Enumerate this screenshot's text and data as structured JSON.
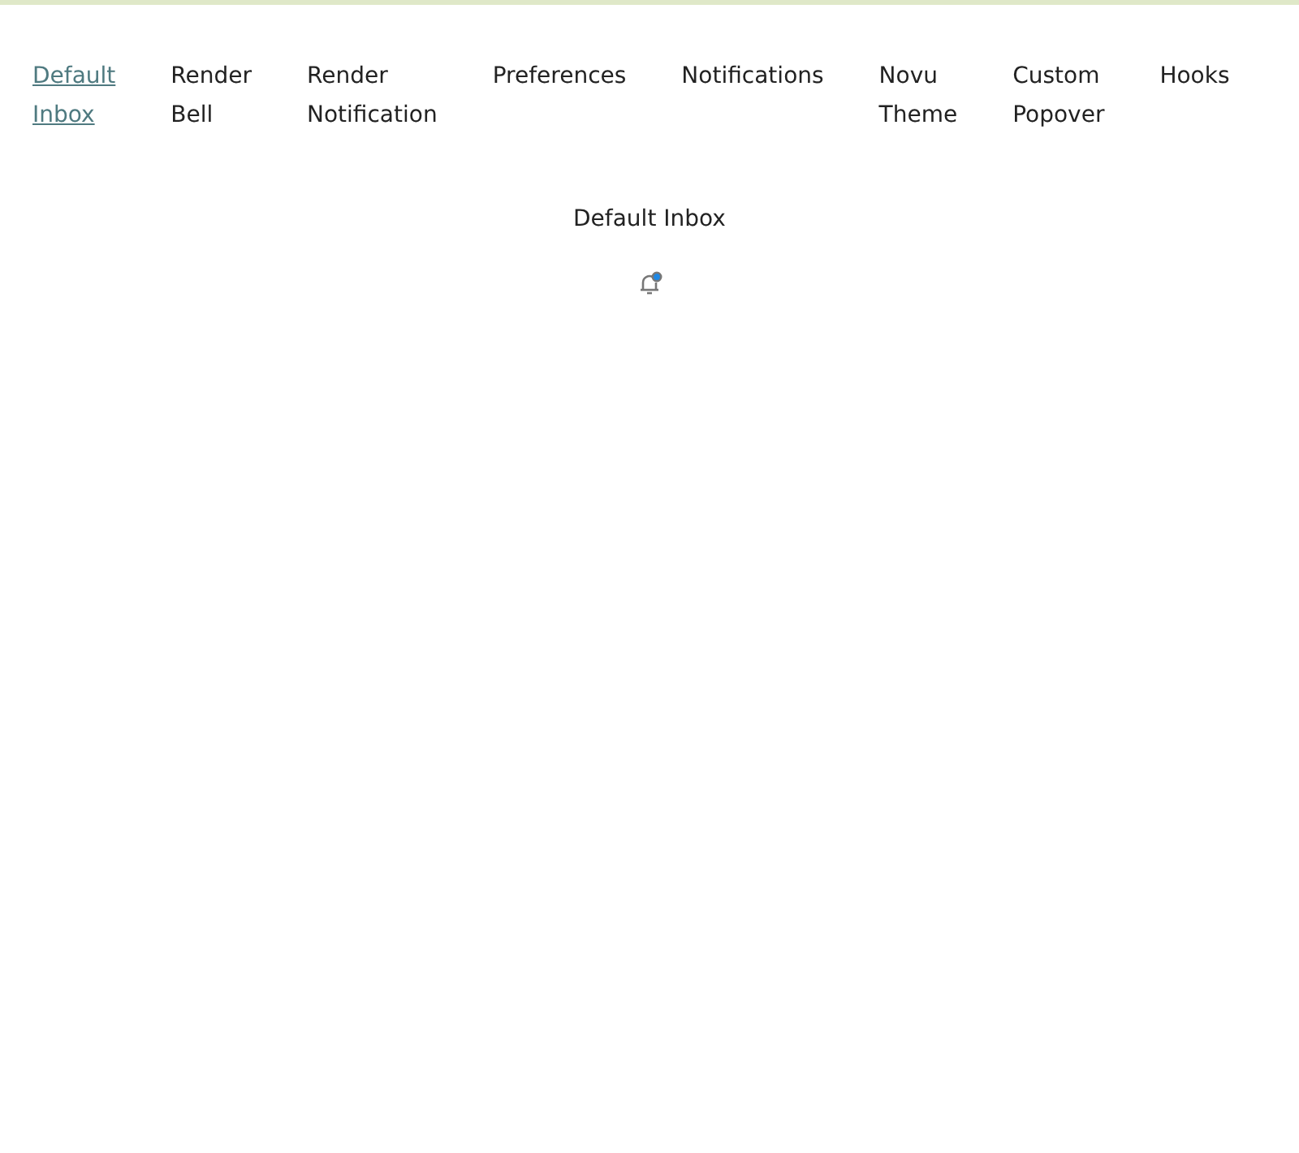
{
  "tabs": [
    {
      "label": "Default Inbox",
      "selected": true
    },
    {
      "label": "Render Bell",
      "selected": false
    },
    {
      "label": "Render Notification",
      "selected": false
    },
    {
      "label": "Preferences",
      "selected": false
    },
    {
      "label": "Notifications",
      "selected": false
    },
    {
      "label": "Novu Theme",
      "selected": false
    },
    {
      "label": "Custom Popover",
      "selected": false
    },
    {
      "label": "Hooks",
      "selected": false
    }
  ],
  "heading": "Default Inbox",
  "bell": {
    "unread": true
  }
}
